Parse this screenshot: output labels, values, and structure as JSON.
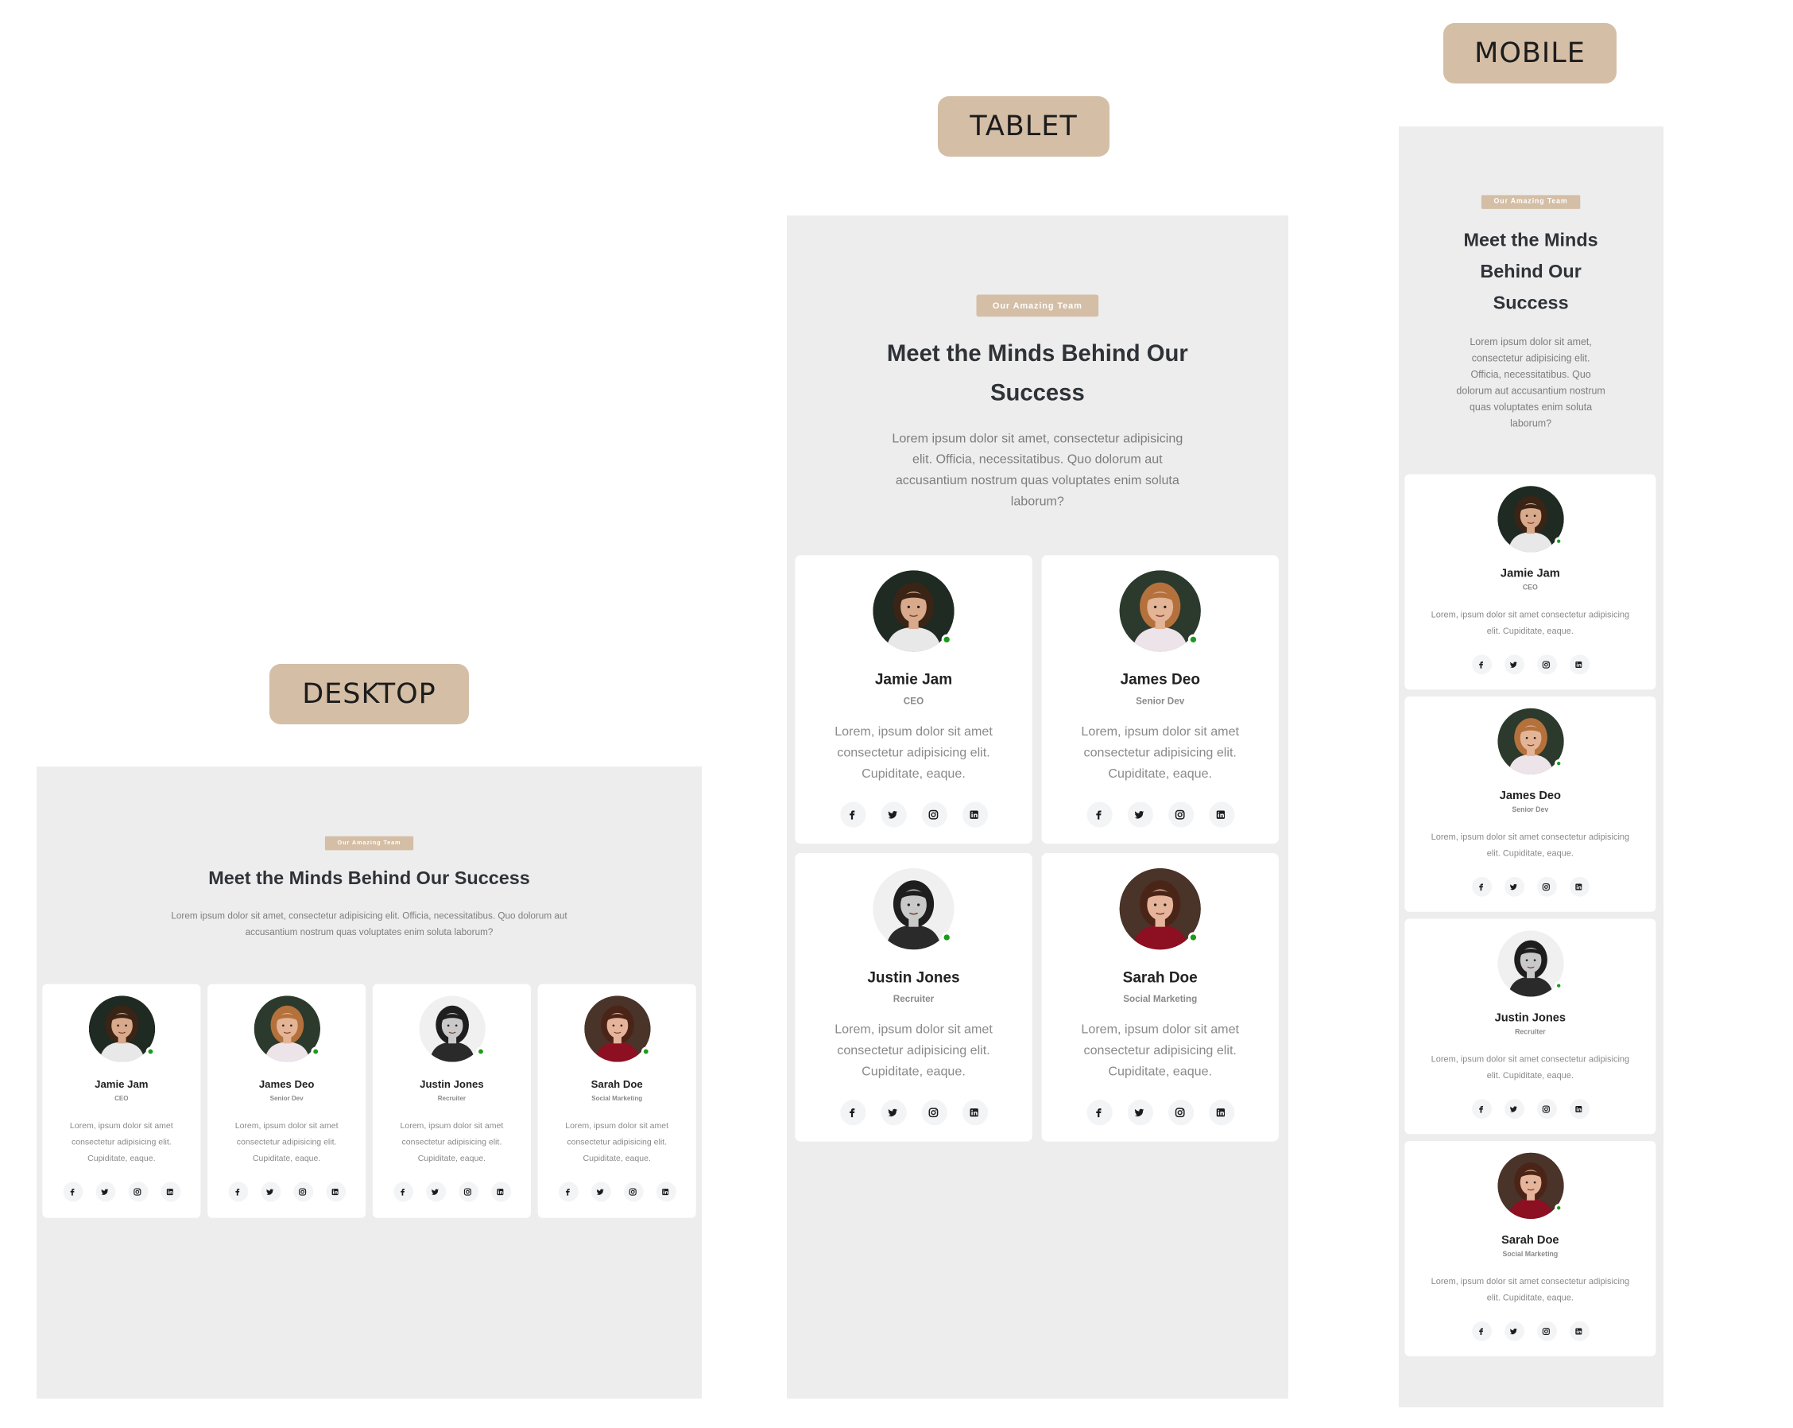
{
  "labels": {
    "desktop": "DESKTOP",
    "tablet": "TABLET",
    "mobile": "MOBILE"
  },
  "section": {
    "badge": "Our Amazing Team",
    "title": "Meet the Minds Behind Our Success",
    "description": "Lorem ipsum dolor sit amet, consectetur adipisicing elit. Officia, necessitatibus. Quo dolorum aut accusantium nostrum quas voluptates enim soluta laborum?"
  },
  "members": [
    {
      "name": "Jamie Jam",
      "role": "CEO",
      "bio": "Lorem, ipsum dolor sit amet consectetur adipisicing elit. Cupiditate, eaque.",
      "avatar": {
        "bg": "#1f2a22",
        "hair": "#3a2416",
        "skin": "#d8a98a",
        "shirt": "#e8e8e8",
        "accent": "#333333"
      }
    },
    {
      "name": "James Deo",
      "role": "Senior Dev",
      "bio": "Lorem, ipsum dolor sit amet consectetur adipisicing elit. Cupiditate, eaque.",
      "avatar": {
        "bg": "#2b3a2c",
        "hair": "#b5713c",
        "skin": "#e3b496",
        "shirt": "#ece4e8",
        "accent": "#111111"
      }
    },
    {
      "name": "Justin Jones",
      "role": "Recruiter",
      "bio": "Lorem, ipsum dolor sit amet consectetur adipisicing elit. Cupiditate, eaque.",
      "avatar": {
        "bg": "#f0f0f0",
        "hair": "#1e1e1e",
        "skin": "#c9c9c9",
        "shirt": "#2a2a2a",
        "accent": "#ffffff"
      }
    },
    {
      "name": "Sarah Doe",
      "role": "Social Marketing",
      "bio": "Lorem, ipsum dolor sit amet consectetur adipisicing elit. Cupiditate, eaque.",
      "avatar": {
        "bg": "#4a3328",
        "hair": "#4b2418",
        "skin": "#e6b49a",
        "shirt": "#8c0f22",
        "accent": "#8c0f22"
      }
    }
  ],
  "socials": [
    {
      "name": "facebook-icon"
    },
    {
      "name": "twitter-icon"
    },
    {
      "name": "instagram-icon"
    },
    {
      "name": "linkedin-icon"
    }
  ],
  "colors": {
    "badge": "#d4bea6",
    "frame_bg": "#ededed",
    "online": "#1a9b1a",
    "title": "#2f3337"
  }
}
